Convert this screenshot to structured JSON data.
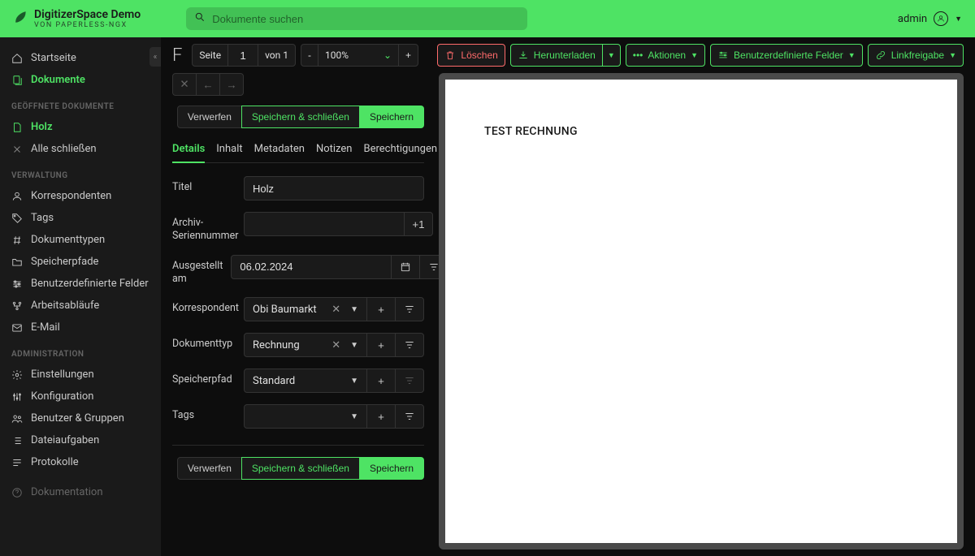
{
  "header": {
    "title": "DigitizerSpace Demo",
    "subtitle": "VON PAPERLESS-NGX",
    "search_placeholder": "Dokumente suchen",
    "user": "admin"
  },
  "sidebar": {
    "main": [
      {
        "icon": "home",
        "label": "Startseite",
        "active": false
      },
      {
        "icon": "documents",
        "label": "Dokumente",
        "active": true
      }
    ],
    "open_docs_header": "GEÖFFNETE DOKUMENTE",
    "open_docs": [
      {
        "icon": "file",
        "label": "Holz"
      }
    ],
    "close_all": "Alle schließen",
    "verwaltung_header": "VERWALTUNG",
    "verwaltung": [
      {
        "icon": "person",
        "label": "Korrespondenten"
      },
      {
        "icon": "tag",
        "label": "Tags"
      },
      {
        "icon": "hash",
        "label": "Dokumenttypen"
      },
      {
        "icon": "folder",
        "label": "Speicherpfade"
      },
      {
        "icon": "sliders",
        "label": "Benutzerdefinierte Felder"
      },
      {
        "icon": "workflow",
        "label": "Arbeitsabläufe"
      },
      {
        "icon": "mail",
        "label": "E-Mail"
      }
    ],
    "admin_header": "ADMINISTRATION",
    "admin": [
      {
        "icon": "gear",
        "label": "Einstellungen"
      },
      {
        "icon": "adjust",
        "label": "Konfiguration"
      },
      {
        "icon": "group",
        "label": "Benutzer & Gruppen"
      },
      {
        "icon": "list",
        "label": "Dateiaufgaben"
      },
      {
        "icon": "log",
        "label": "Protokolle"
      }
    ],
    "doc_link": "Dokumentation"
  },
  "toolbar": {
    "page_label": "Seite",
    "page_value": "1",
    "of_label": "von 1",
    "zoom_value": "100%",
    "delete": "Löschen",
    "download": "Herunterladen",
    "actions": "Aktionen",
    "custom_fields": "Benutzerdefinierte Felder",
    "link_share": "Linkfreigabe"
  },
  "buttons": {
    "discard": "Verwerfen",
    "save_close": "Speichern & schließen",
    "save": "Speichern"
  },
  "tabs": [
    {
      "label": "Details",
      "active": true
    },
    {
      "label": "Inhalt",
      "active": false
    },
    {
      "label": "Metadaten",
      "active": false
    },
    {
      "label": "Notizen",
      "active": false
    },
    {
      "label": "Berechtigungen",
      "active": false
    }
  ],
  "form": {
    "titel_label": "Titel",
    "titel_value": "Holz",
    "asn_label": "Archiv-Seriennummer",
    "asn_plus": "+1",
    "date_label": "Ausgestellt am",
    "date_value": "06.02.2024",
    "korr_label": "Korrespondent",
    "korr_value": "Obi Baumarkt",
    "doctype_label": "Dokumenttyp",
    "doctype_value": "Rechnung",
    "path_label": "Speicherpfad",
    "path_value": "Standard",
    "tags_label": "Tags",
    "tags_value": ""
  },
  "preview": {
    "text": "TEST RECHNUNG"
  }
}
